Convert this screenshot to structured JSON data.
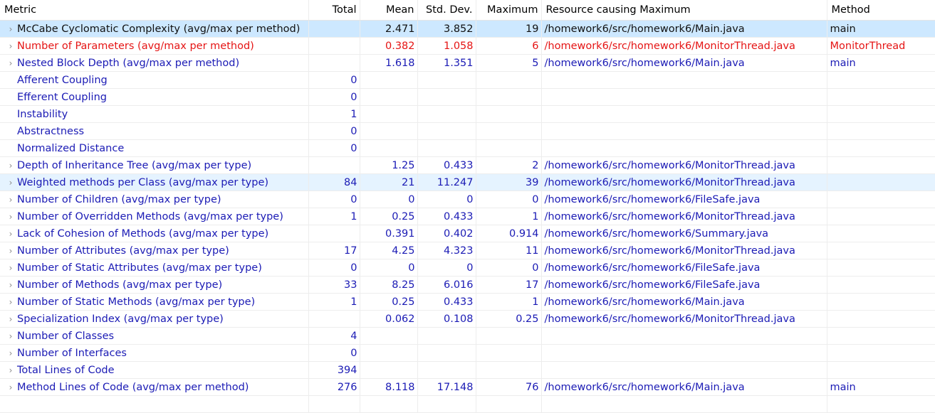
{
  "columns": {
    "metric": "Metric",
    "total": "Total",
    "mean": "Mean",
    "stddev": "Std. Dev.",
    "maximum": "Maximum",
    "resource": "Resource causing Maximum",
    "method": "Method"
  },
  "colors": {
    "normal_text": "#1b1bb5",
    "warning_text": "#e51414",
    "selected_row": "#cde8ff",
    "hover_row": "#e5f3ff"
  },
  "rows": [
    {
      "metric": "McCabe Cyclomatic Complexity (avg/max per method)",
      "total": "",
      "mean": "2.471",
      "stddev": "3.852",
      "maximum": "19",
      "resource": "/homework6/src/homework6/Main.java",
      "method": "main",
      "expandable": true,
      "state": "selected"
    },
    {
      "metric": "Number of Parameters (avg/max per method)",
      "total": "",
      "mean": "0.382",
      "stddev": "1.058",
      "maximum": "6",
      "resource": "/homework6/src/homework6/MonitorThread.java",
      "method": "MonitorThread",
      "expandable": true,
      "state": "warning"
    },
    {
      "metric": "Nested Block Depth (avg/max per method)",
      "total": "",
      "mean": "1.618",
      "stddev": "1.351",
      "maximum": "5",
      "resource": "/homework6/src/homework6/Main.java",
      "method": "main",
      "expandable": true,
      "state": "normal"
    },
    {
      "metric": "Afferent Coupling",
      "total": "0",
      "mean": "",
      "stddev": "",
      "maximum": "",
      "resource": "",
      "method": "",
      "expandable": false,
      "state": "normal"
    },
    {
      "metric": "Efferent Coupling",
      "total": "0",
      "mean": "",
      "stddev": "",
      "maximum": "",
      "resource": "",
      "method": "",
      "expandable": false,
      "state": "normal"
    },
    {
      "metric": "Instability",
      "total": "1",
      "mean": "",
      "stddev": "",
      "maximum": "",
      "resource": "",
      "method": "",
      "expandable": false,
      "state": "normal"
    },
    {
      "metric": "Abstractness",
      "total": "0",
      "mean": "",
      "stddev": "",
      "maximum": "",
      "resource": "",
      "method": "",
      "expandable": false,
      "state": "normal"
    },
    {
      "metric": "Normalized Distance",
      "total": "0",
      "mean": "",
      "stddev": "",
      "maximum": "",
      "resource": "",
      "method": "",
      "expandable": false,
      "state": "normal"
    },
    {
      "metric": "Depth of Inheritance Tree (avg/max per type)",
      "total": "",
      "mean": "1.25",
      "stddev": "0.433",
      "maximum": "2",
      "resource": "/homework6/src/homework6/MonitorThread.java",
      "method": "",
      "expandable": true,
      "state": "normal"
    },
    {
      "metric": "Weighted methods per Class (avg/max per type)",
      "total": "84",
      "mean": "21",
      "stddev": "11.247",
      "maximum": "39",
      "resource": "/homework6/src/homework6/MonitorThread.java",
      "method": "",
      "expandable": true,
      "state": "hover"
    },
    {
      "metric": "Number of Children (avg/max per type)",
      "total": "0",
      "mean": "0",
      "stddev": "0",
      "maximum": "0",
      "resource": "/homework6/src/homework6/FileSafe.java",
      "method": "",
      "expandable": true,
      "state": "normal"
    },
    {
      "metric": "Number of Overridden Methods (avg/max per type)",
      "total": "1",
      "mean": "0.25",
      "stddev": "0.433",
      "maximum": "1",
      "resource": "/homework6/src/homework6/MonitorThread.java",
      "method": "",
      "expandable": true,
      "state": "normal"
    },
    {
      "metric": "Lack of Cohesion of Methods (avg/max per type)",
      "total": "",
      "mean": "0.391",
      "stddev": "0.402",
      "maximum": "0.914",
      "resource": "/homework6/src/homework6/Summary.java",
      "method": "",
      "expandable": true,
      "state": "normal"
    },
    {
      "metric": "Number of Attributes (avg/max per type)",
      "total": "17",
      "mean": "4.25",
      "stddev": "4.323",
      "maximum": "11",
      "resource": "/homework6/src/homework6/MonitorThread.java",
      "method": "",
      "expandable": true,
      "state": "normal"
    },
    {
      "metric": "Number of Static Attributes (avg/max per type)",
      "total": "0",
      "mean": "0",
      "stddev": "0",
      "maximum": "0",
      "resource": "/homework6/src/homework6/FileSafe.java",
      "method": "",
      "expandable": true,
      "state": "normal"
    },
    {
      "metric": "Number of Methods (avg/max per type)",
      "total": "33",
      "mean": "8.25",
      "stddev": "6.016",
      "maximum": "17",
      "resource": "/homework6/src/homework6/FileSafe.java",
      "method": "",
      "expandable": true,
      "state": "normal"
    },
    {
      "metric": "Number of Static Methods (avg/max per type)",
      "total": "1",
      "mean": "0.25",
      "stddev": "0.433",
      "maximum": "1",
      "resource": "/homework6/src/homework6/Main.java",
      "method": "",
      "expandable": true,
      "state": "normal"
    },
    {
      "metric": "Specialization Index (avg/max per type)",
      "total": "",
      "mean": "0.062",
      "stddev": "0.108",
      "maximum": "0.25",
      "resource": "/homework6/src/homework6/MonitorThread.java",
      "method": "",
      "expandable": true,
      "state": "normal"
    },
    {
      "metric": "Number of Classes",
      "total": "4",
      "mean": "",
      "stddev": "",
      "maximum": "",
      "resource": "",
      "method": "",
      "expandable": true,
      "state": "normal"
    },
    {
      "metric": "Number of Interfaces",
      "total": "0",
      "mean": "",
      "stddev": "",
      "maximum": "",
      "resource": "",
      "method": "",
      "expandable": true,
      "state": "normal"
    },
    {
      "metric": "Total Lines of Code",
      "total": "394",
      "mean": "",
      "stddev": "",
      "maximum": "",
      "resource": "",
      "method": "",
      "expandable": true,
      "state": "normal"
    },
    {
      "metric": "Method Lines of Code (avg/max per method)",
      "total": "276",
      "mean": "8.118",
      "stddev": "17.148",
      "maximum": "76",
      "resource": "/homework6/src/homework6/Main.java",
      "method": "main",
      "expandable": true,
      "state": "normal"
    }
  ]
}
